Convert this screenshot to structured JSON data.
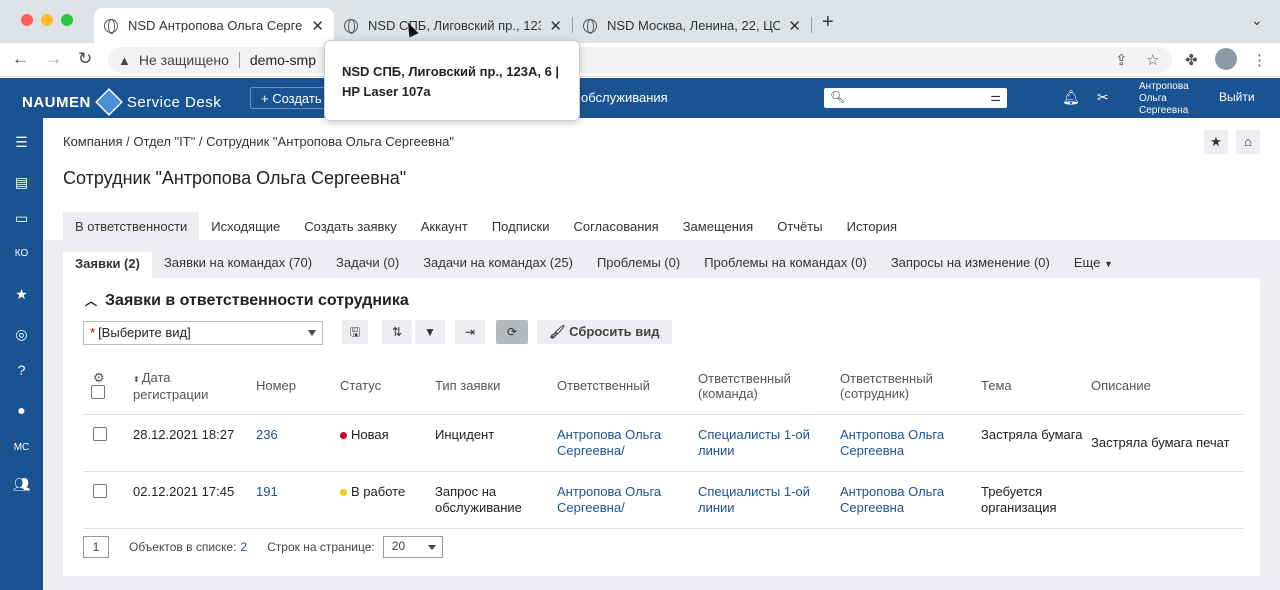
{
  "browser": {
    "tabs": [
      {
        "title": "NSD Антропова Ольга Сергее"
      },
      {
        "title": "NSD СПБ, Лиговский пр., 123"
      },
      {
        "title": "NSD Москва, Ленина, 22, ЦОД"
      }
    ],
    "new_tab": "+",
    "address": {
      "security": "Не защищено",
      "url": "demo-smp"
    },
    "tooltip": "NSD СПБ, Лиговский пр., 123А, 6 | HP Laser 107a"
  },
  "app": {
    "logo_naumen": "NAUMEN",
    "logo_sd": "Service Desk",
    "create_label": "+ Создать",
    "header_link": "обслуживания",
    "search_placeholder": "",
    "user_name": "Антропова Ольга Сергеевна",
    "logout": "Выйти"
  },
  "sidebar": {
    "items": [
      {
        "icon": "menu-icon"
      },
      {
        "icon": "document-icon"
      },
      {
        "icon": "monitor-icon"
      },
      {
        "label": "КО"
      },
      {
        "icon": "star-icon"
      },
      {
        "icon": "lifebuoy-icon"
      },
      {
        "icon": "help-icon"
      },
      {
        "icon": "user-icon"
      },
      {
        "label": "МС"
      },
      {
        "icon": "team-icon"
      }
    ]
  },
  "page": {
    "breadcrumb": "Компания / Отдел \"IT\" / Сотрудник \"Антропова Ольга Сергеевна\"",
    "title": "Сотрудник \"Антропова Ольга Сергеевна\"",
    "main_tabs": [
      "В ответственности",
      "Исходящие",
      "Создать заявку",
      "Аккаунт",
      "Подписки",
      "Согласования",
      "Замещения",
      "Отчёты",
      "История"
    ],
    "sub_tabs": [
      "Заявки (2)",
      "Заявки на командах (70)",
      "Задачи (0)",
      "Задачи на командах (25)",
      "Проблемы (0)",
      "Проблемы на командах (0)",
      "Запросы на изменение (0)",
      "Еще"
    ]
  },
  "list": {
    "title": "Заявки в ответственности сотрудника",
    "view_select": "[Выберите вид]",
    "reset_view": "Сбросить вид",
    "columns": [
      "Дата регистрации",
      "Номер",
      "Статус",
      "Тип заявки",
      "Ответственный",
      "Ответственный (команда)",
      "Ответственный (сотрудник)",
      "Тема",
      "Описание"
    ],
    "rows": [
      {
        "date": "28.12.2021 18:27",
        "number": "236",
        "status": "Новая",
        "status_color": "#d0021b",
        "type": "Инцидент",
        "responsible": "Антропова Ольга Сергеевна/",
        "team": "Специалисты 1-ой линии",
        "employee": "Антропова Ольга Сергеевна",
        "subject": "Застряла бумага",
        "description": "Застряла бумага печат"
      },
      {
        "date": "02.12.2021 17:45",
        "number": "191",
        "status": "В работе",
        "status_color": "#f0d000",
        "type": "Запрос на обслуживание",
        "responsible": "Антропова Ольга Сергеевна/",
        "team": "Специалисты 1-ой линии",
        "employee": "Антропова Ольга Сергеевна",
        "subject": "Требуется организация",
        "description": ""
      }
    ],
    "pager": {
      "page": "1",
      "objects_label": "Объектов в списке:",
      "objects_count": "2",
      "per_page_label": "Строк на странице:",
      "per_page": "20"
    }
  },
  "colors": {
    "brand": "#1a5392",
    "link": "#1a5392"
  }
}
